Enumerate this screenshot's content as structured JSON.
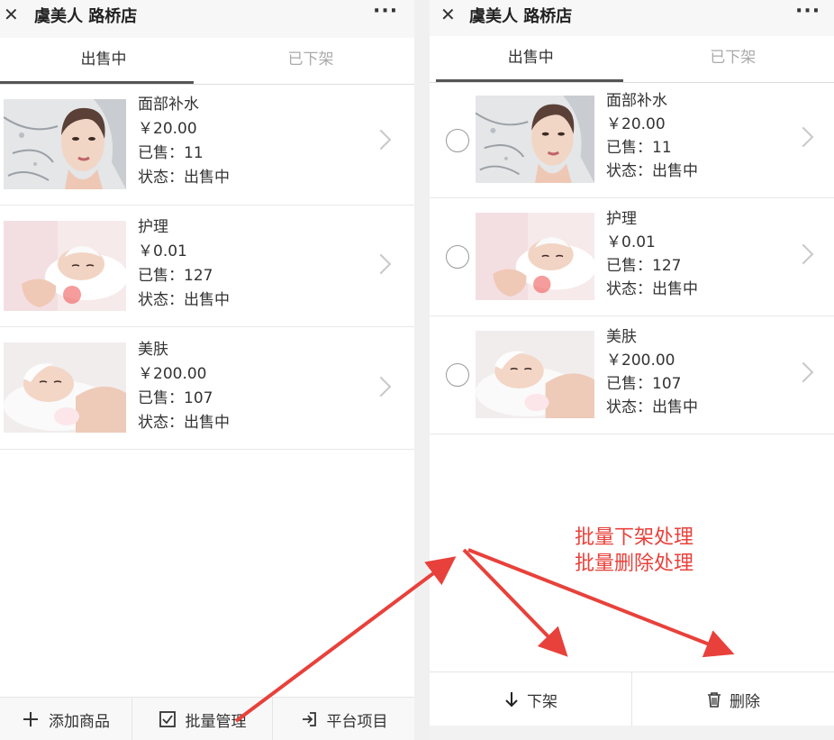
{
  "store_title": "虞美人 路桥店",
  "close_symbol": "✕",
  "more_symbol": "···",
  "tabs": [
    "出售中",
    "已下架"
  ],
  "products": [
    {
      "name": "面部补水",
      "price": "￥20.00",
      "sold": "已售：11",
      "status": "状态：出售中",
      "image": "woman-face-water-splash"
    },
    {
      "name": "护理",
      "price": "￥0.01",
      "sold": "已售：127",
      "status": "状态：出售中",
      "image": "facial-massage"
    },
    {
      "name": "美肤",
      "price": "￥200.00",
      "sold": "已售：107",
      "status": "状态：出售中",
      "image": "skin-care-sponge"
    }
  ],
  "left_footer": {
    "add_label": "添加商品",
    "batch_label": "批量管理",
    "platform_label": "平台项目",
    "add_icon": "plus-icon",
    "batch_icon": "checkbox-icon",
    "platform_icon": "import-icon"
  },
  "right_footer": {
    "delist_label": "下架",
    "delete_label": "删除",
    "delist_icon": "arrow-down-icon",
    "delete_icon": "trash-icon"
  },
  "annotation": {
    "line1": "批量下架处理",
    "line2": "批量删除处理",
    "color": "#e8413b"
  }
}
